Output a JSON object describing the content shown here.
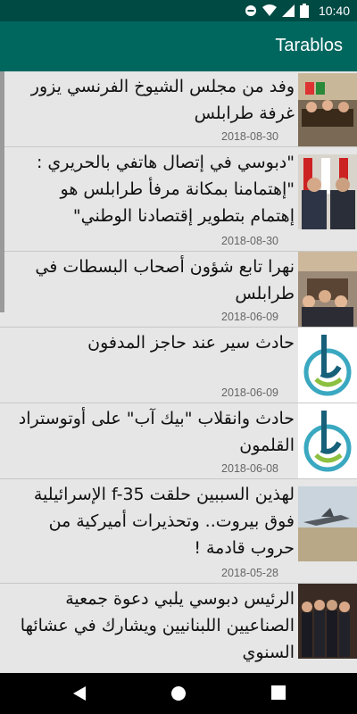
{
  "status": {
    "time": "10:40"
  },
  "app": {
    "title": "Tarablos"
  },
  "articles": [
    {
      "title": "وفد من مجلس الشيوخ الفرنسي يزور غرفة طرابلس",
      "date": "2018-08-30",
      "thumb": "photo-meeting"
    },
    {
      "title": "\"دبوسي في إتصال هاتفي بالحريري : \"إهتمامنا بمكانة مرفأ طرابلس هو إهتمام بتطوير إقتصادنا الوطني\"",
      "date": "2018-08-30",
      "thumb": "photo-leaders"
    },
    {
      "title": "نهرا تابع شؤون أصحاب البسطات في طرابلس",
      "date": "2018-06-09",
      "thumb": "photo-meeting-room"
    },
    {
      "title": "حادث سير عند حاجز المدفون",
      "date": "2018-06-09",
      "thumb": "tarablos-logo"
    },
    {
      "title": "حادث وانقلاب \"بيك آب\" على أوتوستراد القلمون",
      "date": "2018-06-08",
      "thumb": "tarablos-logo"
    },
    {
      "title": "لهذين السببين حلقت f-35 الإسرائيلية فوق بيروت.. وتحذيرات أميركية من حروب قادمة !",
      "date": "2018-05-28",
      "thumb": "photo-jet"
    },
    {
      "title": "الرئيس دبوسي يلبي دعوة جمعية الصناعيين اللبنانيين ويشارك في عشائها السنوي",
      "date": "",
      "thumb": "photo-group"
    }
  ]
}
